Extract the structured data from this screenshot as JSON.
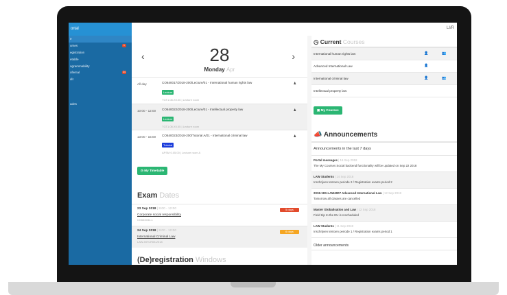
{
  "sidebar": {
    "brand": "ortal",
    "items": [
      {
        "label": "e",
        "badge": "",
        "badge_color": "",
        "active": true
      },
      {
        "label": "urses",
        "badge": "1",
        "badge_color": "#e24b2c",
        "active": false
      },
      {
        "label": "egistration",
        "badge": "",
        "badge_color": "",
        "active": false
      },
      {
        "label": "etable",
        "badge": "",
        "badge_color": "",
        "active": false
      },
      {
        "label": "ogrammability",
        "badge": "",
        "badge_color": "",
        "active": false
      },
      {
        "label": "ofernal",
        "badge": "34",
        "badge_color": "#e24b2c",
        "active": false
      },
      {
        "label": "dit",
        "badge": "",
        "badge_color": "",
        "active": false
      }
    ],
    "extra": "ades"
  },
  "topbar": {
    "user": "LI/R"
  },
  "timetable": {
    "prev_glyph": "‹",
    "next_glyph": "›",
    "day_number": "28",
    "weekday": "Monday",
    "month": "Apr",
    "events": [
      {
        "time": "All day",
        "title": "CO640017/2018-200/Lecture/01 - International human rights law",
        "badge": "Lecture",
        "badge_color": "#2bb673",
        "location": "TGT1.08.X0.05 | Lecture room"
      },
      {
        "time": "10:00 - 12:00",
        "title": "CO640022/2018-200/Lecture/01 - Intellectual property law",
        "badge": "Lecture",
        "badge_color": "#2bb673",
        "location": "TGT1.08.X0.05 | Lecture room"
      },
      {
        "time": "13:00 - 15:00",
        "title": "CO640023/2018-200/Tutorial A/01 - International criminal law",
        "badge": "Tutorial",
        "badge_color": "#1c3ddb",
        "location": "APSM 0.05.00 | Lecture room A"
      }
    ],
    "button": "My Timetable"
  },
  "exams": {
    "title_bold": "Exam",
    "title_light": "Dates",
    "items": [
      {
        "date": "23 Sep 2018",
        "sub": "| 9:00 - 12:00",
        "name": "Corporate social responsibility",
        "code": "CO640034-1",
        "badge": "5 days",
        "badge_color": "#e24b2c"
      },
      {
        "date": "24 Sep 2018",
        "sub": "| 9:00 - 12:00",
        "name": "International Criminal Law",
        "code": "LAW-INTCRIM-2018",
        "badge": "6 days",
        "badge_color": "#f5a623"
      }
    ]
  },
  "deregistration": {
    "title_bold": "(De)registration",
    "title_light": "Windows"
  },
  "courses": {
    "title_bold": "Current",
    "title_light": "Courses",
    "items": [
      {
        "name": "International human rights law",
        "icon_a": "👤",
        "icon_b": "👥"
      },
      {
        "name": "Advanced International Law",
        "icon_a": "👤",
        "icon_b": ""
      },
      {
        "name": "International criminal law",
        "icon_a": "👤",
        "icon_b": "👥"
      },
      {
        "name": "Intellectual property law",
        "icon_a": "",
        "icon_b": ""
      }
    ],
    "button": "My Courses"
  },
  "announcements": {
    "title": "Announcements",
    "subtitle": "Announcements in the last 7 days",
    "items": [
      {
        "title": "Portal messages",
        "sub": "| 16 Sep 2018",
        "text": "The My Courses Social backend functionality will be updated on Sep 22 2018"
      },
      {
        "title": "LAW Students",
        "sub": "| 14 Sep 2018",
        "text": "Inschrijven tentoen periode 2 / Registration exams period 2"
      },
      {
        "title": "2018-19S-LAW4007 Advanced International Law",
        "sub": "| 12 Sep 2018",
        "text": "Tomorrow all classes are cancelled"
      },
      {
        "title": "Master Globalisation and Law",
        "sub": "| 12 Sep 2018",
        "text": "Field trip to the EU is rescheduled"
      },
      {
        "title": "LAW Students",
        "sub": "| 11 Sep 2018",
        "text": "Inschrijven tentoen periode 1 / Registration exams period 1"
      }
    ],
    "older": "Older announcements"
  }
}
